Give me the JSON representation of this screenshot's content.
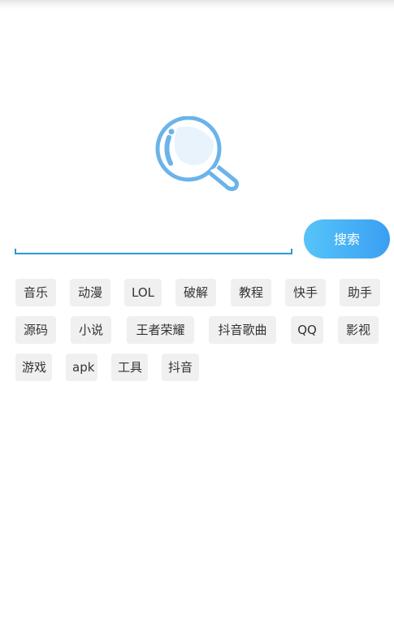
{
  "search": {
    "value": "",
    "placeholder": "",
    "button_label": "搜索"
  },
  "tags": [
    "音乐",
    "动漫",
    "LOL",
    "破解",
    "教程",
    "快手",
    "助手",
    "源码",
    "小说",
    "王者荣耀",
    "抖音歌曲",
    "QQ",
    "影视",
    "游戏",
    "apk",
    "工具",
    "抖音"
  ],
  "colors": {
    "accent": "#3a9ff3",
    "accent_light": "#56c4f8",
    "underline": "#2a9bd6",
    "tag_background": "#f0f0f0",
    "logo_stroke": "#6ab4ea"
  },
  "icons": {
    "logo": "magnifier-bubble-icon"
  }
}
